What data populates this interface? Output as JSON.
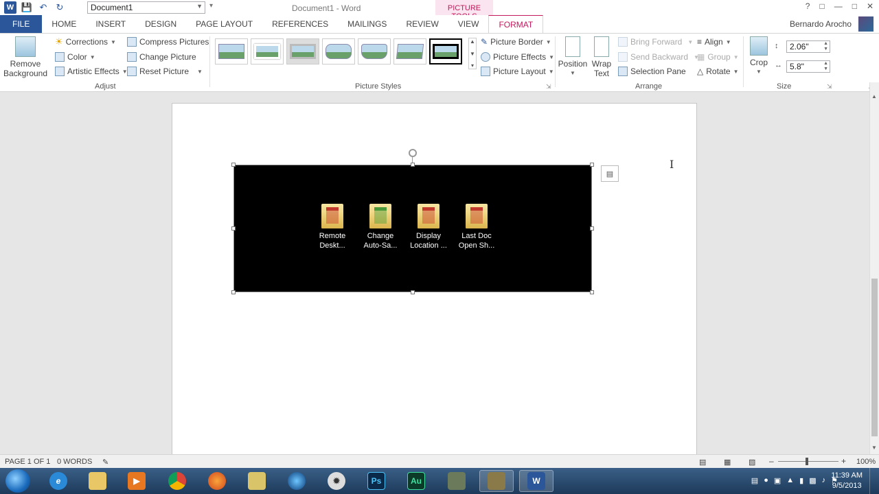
{
  "window": {
    "title": "Document1 - Word",
    "doc_name": "Document1",
    "context_tab_title": "PICTURE TOOLS",
    "user": "Bernardo Arocho"
  },
  "tabs": [
    "FILE",
    "HOME",
    "INSERT",
    "DESIGN",
    "PAGE LAYOUT",
    "REFERENCES",
    "MAILINGS",
    "REVIEW",
    "VIEW",
    "FORMAT"
  ],
  "ribbon": {
    "adjust": {
      "label": "Adjust",
      "remove_background": "Remove Background",
      "corrections": "Corrections",
      "color": "Color",
      "artistic_effects": "Artistic Effects",
      "compress": "Compress Pictures",
      "change": "Change Picture",
      "reset": "Reset Picture"
    },
    "picture_styles": {
      "label": "Picture Styles",
      "border": "Picture Border",
      "effects": "Picture Effects",
      "layout": "Picture Layout"
    },
    "arrange": {
      "label": "Arrange",
      "position": "Position",
      "wrap_text": "Wrap Text",
      "bring_forward": "Bring Forward",
      "send_backward": "Send Backward",
      "selection_pane": "Selection Pane",
      "align": "Align",
      "group": "Group",
      "rotate": "Rotate"
    },
    "size": {
      "label": "Size",
      "crop": "Crop",
      "height": "2.06\"",
      "width": "5.8\""
    }
  },
  "picture": {
    "folders": [
      {
        "line1": "Remote",
        "line2": "Deskt...",
        "accent": "#c0392b"
      },
      {
        "line1": "Change",
        "line2": "Auto-Sa...",
        "accent": "#4a9a3a"
      },
      {
        "line1": "Display",
        "line2": "Location ...",
        "accent": "#c0392b"
      },
      {
        "line1": "Last Doc",
        "line2": "Open Sh...",
        "accent": "#c0392b"
      }
    ]
  },
  "status": {
    "page": "PAGE 1 OF 1",
    "words": "0 WORDS",
    "zoom": "100%"
  },
  "taskbar": {
    "photoshop": "Ps",
    "audition": "Au",
    "word": "W",
    "time": "11:39 AM",
    "date": "9/5/2013"
  },
  "colors": {
    "file_tab": "#2b579a",
    "context_accent": "#c2185b"
  }
}
